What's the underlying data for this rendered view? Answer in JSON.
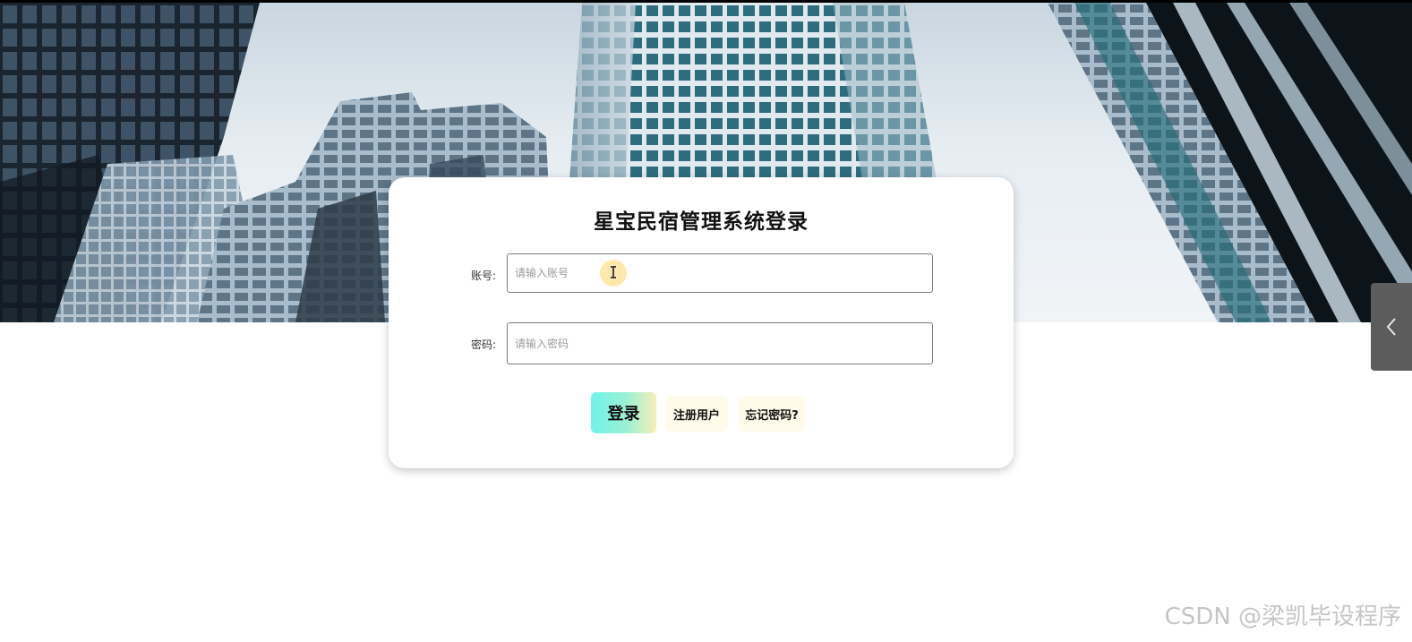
{
  "login": {
    "title": "星宝民宿管理系统登录",
    "account_label": "账号:",
    "account_placeholder": "请输入账号",
    "account_value": "",
    "password_label": "密码:",
    "password_placeholder": "请输入密码",
    "password_value": "",
    "login_button": "登录",
    "register_button": "注册用户",
    "forgot_button": "忘记密码?"
  },
  "side_tab": {
    "icon": "chevron-left-icon"
  },
  "watermark": {
    "text": "CSDN @梁凯毕设程序"
  },
  "colors": {
    "login_gradient_start": "#6ff3ea",
    "login_gradient_end": "#f7efb8",
    "secondary_button_bg": "#fffbea",
    "side_tab_bg": "#5c5c5c",
    "cursor_highlight": "#ffd666"
  }
}
